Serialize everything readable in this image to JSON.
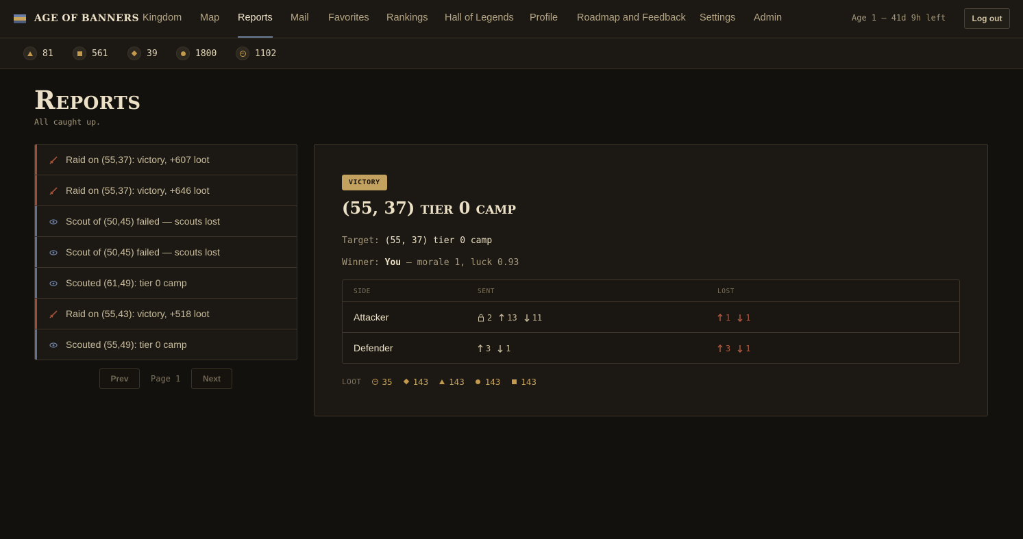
{
  "brand": {
    "name": "AGE OF BANNERS"
  },
  "nav": {
    "items": [
      "Kingdom",
      "Map",
      "Reports",
      "Mail",
      "Favorites",
      "Rankings",
      "Hall of Legends",
      "Profile",
      "Roadmap and Feedback",
      "Settings",
      "Admin"
    ],
    "active": "Reports",
    "age_status": "Age 1 — 41d 9h left",
    "logout_label": "Log out"
  },
  "resources": [
    {
      "icon": "triangle-icon",
      "value": "81"
    },
    {
      "icon": "square-icon",
      "value": "561"
    },
    {
      "icon": "diamond-icon",
      "value": "39"
    },
    {
      "icon": "circle-icon",
      "value": "1800"
    },
    {
      "icon": "minus-circle-icon",
      "value": "1102"
    }
  ],
  "page": {
    "title": "Reports",
    "subtitle": "All caught up."
  },
  "reports": [
    {
      "type": "raid",
      "icon": "sword-icon",
      "text": "Raid on (55,37): victory, +607 loot"
    },
    {
      "type": "raid",
      "icon": "sword-icon",
      "text": "Raid on (55,37): victory, +646 loot"
    },
    {
      "type": "scout",
      "icon": "eye-icon",
      "text": "Scout of (50,45) failed — scouts lost"
    },
    {
      "type": "scout",
      "icon": "eye-icon",
      "text": "Scout of (50,45) failed — scouts lost"
    },
    {
      "type": "scout",
      "icon": "eye-icon",
      "text": "Scouted (61,49): tier 0 camp"
    },
    {
      "type": "raid",
      "icon": "sword-icon",
      "text": "Raid on (55,43): victory, +518 loot"
    },
    {
      "type": "scout",
      "icon": "eye-icon",
      "text": "Scouted (55,49): tier 0 camp"
    }
  ],
  "pager": {
    "prev": "Prev",
    "page_label": "Page 1",
    "next": "Next"
  },
  "detail": {
    "badge": "VICTORY",
    "title": "(55, 37) tier 0 camp",
    "target_label": "Target:",
    "target_value": "(55, 37) tier 0 camp",
    "winner_label": "Winner:",
    "winner_value": "You",
    "winner_extra": "— morale 1, luck 0.93",
    "table": {
      "headers": [
        "SIDE",
        "SENT",
        "LOST"
      ],
      "rows": [
        {
          "side": "Attacker",
          "sent": [
            {
              "icon": "lock-icon",
              "value": "2"
            },
            {
              "icon": "arrow-up-icon",
              "value": "13"
            },
            {
              "icon": "arrow-down-icon",
              "value": "11"
            }
          ],
          "lost": [
            {
              "icon": "arrow-up-icon",
              "value": "1"
            },
            {
              "icon": "arrow-down-icon",
              "value": "1"
            }
          ]
        },
        {
          "side": "Defender",
          "sent": [
            {
              "icon": "arrow-up-icon",
              "value": "3"
            },
            {
              "icon": "arrow-down-icon",
              "value": "1"
            }
          ],
          "lost": [
            {
              "icon": "arrow-up-icon",
              "value": "3"
            },
            {
              "icon": "arrow-down-icon",
              "value": "1"
            }
          ]
        }
      ]
    },
    "loot_label": "LOOT",
    "loot": [
      {
        "icon": "minus-circle-icon",
        "value": "35"
      },
      {
        "icon": "diamond-icon",
        "value": "143"
      },
      {
        "icon": "triangle-icon",
        "value": "143"
      },
      {
        "icon": "circle-icon",
        "value": "143"
      },
      {
        "icon": "square-icon",
        "value": "143"
      }
    ]
  },
  "colors": {
    "accent": "#c3a15e",
    "raid": "#9b4f3a",
    "scout": "#5f7194",
    "lost": "#b35a40"
  }
}
